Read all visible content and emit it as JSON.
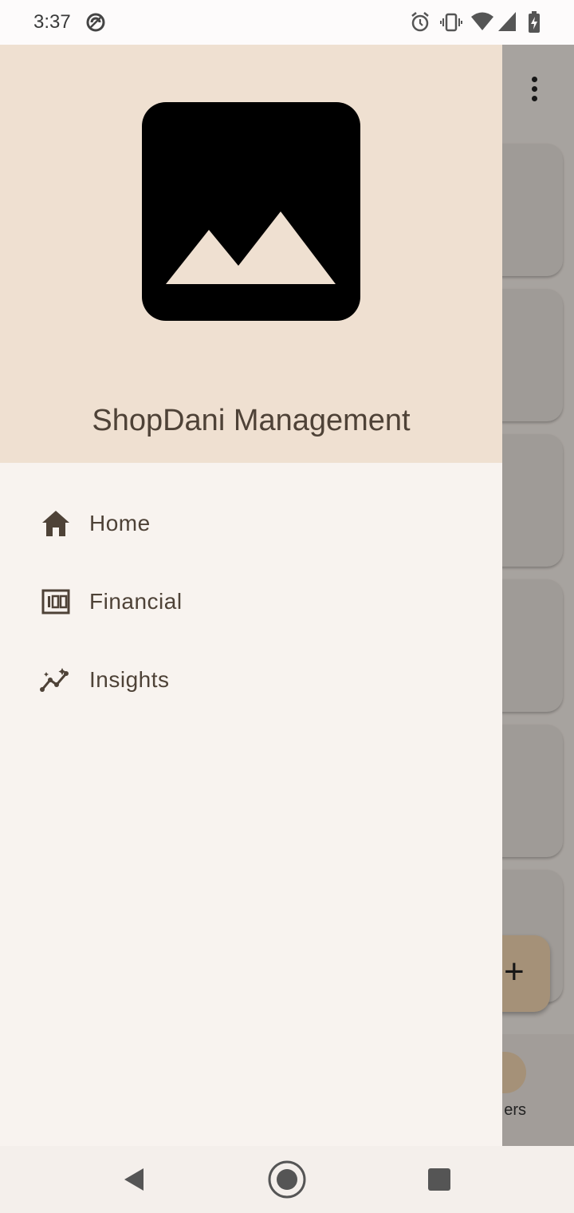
{
  "status_bar": {
    "time": "3:37",
    "icons": [
      "no-disturb-icon",
      "alarm-icon",
      "vibrate-icon",
      "wifi-icon",
      "cellular-signal-icon",
      "battery-charging-icon"
    ]
  },
  "drawer": {
    "header_image_icon": "image-placeholder-icon",
    "title": "ShopDani Management",
    "items": [
      {
        "icon": "home-icon",
        "label": "Home"
      },
      {
        "icon": "money-icon",
        "label": "Financial"
      },
      {
        "icon": "insights-icon",
        "label": "Insights"
      }
    ]
  },
  "background_app": {
    "fab_icon": "plus-icon",
    "fab_label": "+",
    "bottom_nav_partial_label": "ers",
    "more_icon": "more-vert-icon"
  },
  "system_nav": {
    "back": "back-icon",
    "home": "home-circle-icon",
    "recents": "recents-icon"
  },
  "colors": {
    "drawer_header_bg": "#efe0d1",
    "drawer_bg": "#f8f3ef",
    "text": "#4e4237",
    "fab": "#f3d6b2"
  }
}
